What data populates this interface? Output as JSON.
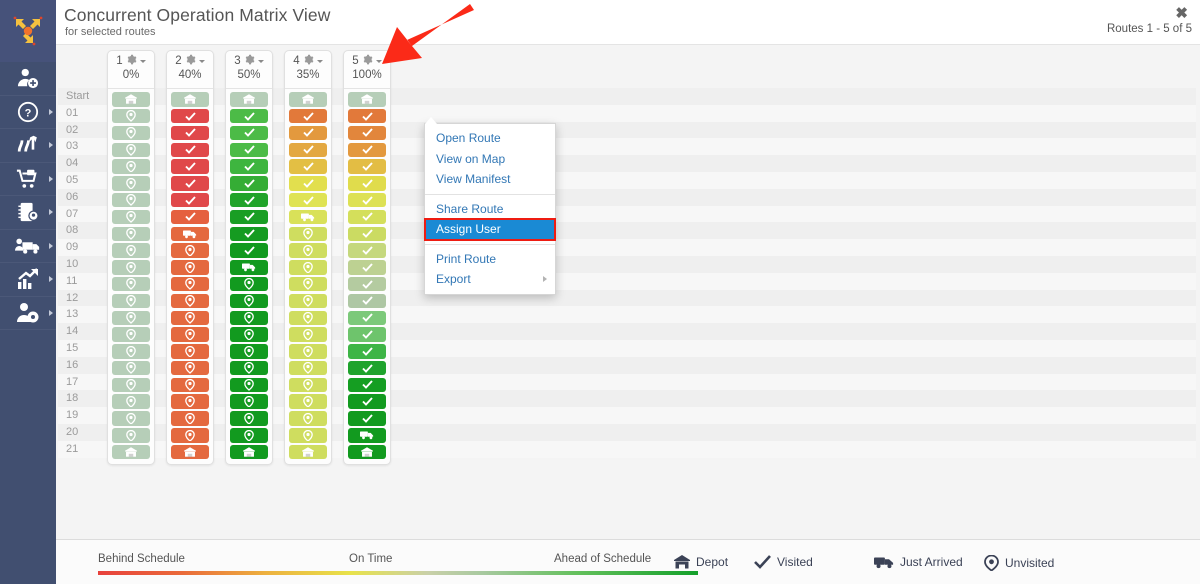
{
  "header": {
    "title": "Concurrent Operation Matrix View",
    "subtitle": "for selected routes",
    "close_label": "✖",
    "routes_count": "Routes 1 - 5 of 5"
  },
  "sidebar": {
    "logo_name": "route-optimization-logo",
    "items": [
      {
        "name": "add-user-icon",
        "has_caret": false
      },
      {
        "name": "help-icon",
        "has_caret": true
      },
      {
        "name": "routes-icon",
        "has_caret": true
      },
      {
        "name": "orders-cart-icon",
        "has_caret": true
      },
      {
        "name": "address-book-icon",
        "has_caret": true
      },
      {
        "name": "fleet-truck-icon",
        "has_caret": true
      },
      {
        "name": "reports-chart-icon",
        "has_caret": true
      },
      {
        "name": "user-settings-icon",
        "has_caret": true
      }
    ]
  },
  "matrix": {
    "row_labels": [
      "Start",
      "01",
      "02",
      "03",
      "04",
      "05",
      "06",
      "07",
      "08",
      "09",
      "10",
      "11",
      "12",
      "13",
      "14",
      "15",
      "16",
      "17",
      "18",
      "19",
      "20",
      "21"
    ],
    "columns": [
      {
        "number": "1",
        "percent": "0%",
        "colors": [
          "#b6ceb8",
          "#b6ceb8",
          "#b6ceb8",
          "#b6ceb8",
          "#b6ceb8",
          "#b6ceb8",
          "#b6ceb8",
          "#b6ceb8",
          "#b6ceb8",
          "#b6ceb8",
          "#b6ceb8",
          "#b6ceb8",
          "#b6ceb8",
          "#b6ceb8",
          "#b6ceb8",
          "#b6ceb8",
          "#b6ceb8",
          "#b6ceb8",
          "#b6ceb8",
          "#b6ceb8",
          "#b6ceb8",
          "#b6ceb8"
        ],
        "icons": [
          "depot",
          "pin",
          "pin",
          "pin",
          "pin",
          "pin",
          "pin",
          "pin",
          "pin",
          "pin",
          "pin",
          "pin",
          "pin",
          "pin",
          "pin",
          "pin",
          "pin",
          "pin",
          "pin",
          "pin",
          "pin",
          "depot"
        ]
      },
      {
        "number": "2",
        "percent": "40%",
        "colors": [
          "#b6ceb8",
          "#e0484a",
          "#e0484a",
          "#e0484a",
          "#e0484a",
          "#e0484a",
          "#e0484a",
          "#e5603f",
          "#e4693f",
          "#e4693f",
          "#e4693f",
          "#e4693f",
          "#e4693f",
          "#e4693f",
          "#e4693f",
          "#e4693f",
          "#e4693f",
          "#e4693f",
          "#e4693f",
          "#e4693f",
          "#e4693f",
          "#e4693f"
        ],
        "icons": [
          "depot",
          "check",
          "check",
          "check",
          "check",
          "check",
          "check",
          "check",
          "truck",
          "pin",
          "pin",
          "pin",
          "pin",
          "pin",
          "pin",
          "pin",
          "pin",
          "pin",
          "pin",
          "pin",
          "pin",
          "depot"
        ]
      },
      {
        "number": "3",
        "percent": "50%",
        "colors": [
          "#b6ceb8",
          "#4cbb47",
          "#4cbb47",
          "#4cbb47",
          "#3eb53f",
          "#35ad35",
          "#21a32a",
          "#199e24",
          "#159b21",
          "#129a1f",
          "#129a1f",
          "#129a1f",
          "#129a1f",
          "#129a1f",
          "#129a1f",
          "#129a1f",
          "#129a1f",
          "#129a1f",
          "#129a1f",
          "#129a1f",
          "#129a1f",
          "#129a1f"
        ],
        "icons": [
          "depot",
          "check",
          "check",
          "check",
          "check",
          "check",
          "check",
          "check",
          "check",
          "check",
          "truck",
          "pin",
          "pin",
          "pin",
          "pin",
          "pin",
          "pin",
          "pin",
          "pin",
          "pin",
          "pin",
          "depot"
        ]
      },
      {
        "number": "4",
        "percent": "35%",
        "colors": [
          "#b6ceb8",
          "#e2793a",
          "#e3993e",
          "#e3a841",
          "#e3bf44",
          "#e2df4e",
          "#dfe354",
          "#d9e159",
          "#cfdd5f",
          "#cfdd5f",
          "#cfdd5f",
          "#cfdd5f",
          "#cfdd5f",
          "#cfdd5f",
          "#cfdd5f",
          "#cfdd5f",
          "#cfdd5f",
          "#cfdd5f",
          "#cfdd5f",
          "#cfdd5f",
          "#cfdd5f",
          "#cfdd5f"
        ],
        "icons": [
          "depot",
          "check",
          "check",
          "check",
          "check",
          "check",
          "check",
          "truck",
          "pin",
          "pin",
          "pin",
          "pin",
          "pin",
          "pin",
          "pin",
          "pin",
          "pin",
          "pin",
          "pin",
          "pin",
          "pin",
          "depot"
        ]
      },
      {
        "number": "5",
        "percent": "100%",
        "colors": [
          "#b6ceb8",
          "#e2793a",
          "#e2863c",
          "#e3993e",
          "#e3bd44",
          "#e0dc4c",
          "#dde155",
          "#d4df5b",
          "#cbdb62",
          "#c5d87d",
          "#bdd192",
          "#b4cba0",
          "#aec7a4",
          "#7cc97a",
          "#6ec46c",
          "#3eb546",
          "#1fa32c",
          "#159e22",
          "#129a1f",
          "#129a1f",
          "#129a1f",
          "#129a1f"
        ],
        "icons": [
          "depot",
          "check",
          "check",
          "check",
          "check",
          "check",
          "check",
          "check",
          "check",
          "check",
          "check",
          "check",
          "check",
          "check",
          "check",
          "check",
          "check",
          "check",
          "check",
          "check",
          "truck",
          "depot"
        ]
      }
    ]
  },
  "context_menu": {
    "items": [
      {
        "label": "Open Route",
        "active": false,
        "submenu": false,
        "sep_after": false
      },
      {
        "label": "View on Map",
        "active": false,
        "submenu": false,
        "sep_after": false
      },
      {
        "label": "View Manifest",
        "active": false,
        "submenu": false,
        "sep_after": true
      },
      {
        "label": "Share Route",
        "active": false,
        "submenu": false,
        "sep_after": false
      },
      {
        "label": "Assign User",
        "active": true,
        "submenu": false,
        "sep_after": true
      },
      {
        "label": "Print Route",
        "active": false,
        "submenu": false,
        "sep_after": false
      },
      {
        "label": "Export",
        "active": false,
        "submenu": true,
        "sep_after": false
      }
    ],
    "highlight_color": "#1a8ad4",
    "annotation_color": "#ee1c12"
  },
  "footer": {
    "gradient": {
      "behind": "Behind Schedule",
      "ontime": "On Time",
      "ahead": "Ahead of Schedule"
    },
    "legend": [
      {
        "label": "Depot",
        "icon": "depot-icon"
      },
      {
        "label": "Visited",
        "icon": "check-icon"
      },
      {
        "label": "Just Arrived",
        "icon": "truck-icon"
      },
      {
        "label": "Unvisited",
        "icon": "pin-icon"
      }
    ]
  }
}
